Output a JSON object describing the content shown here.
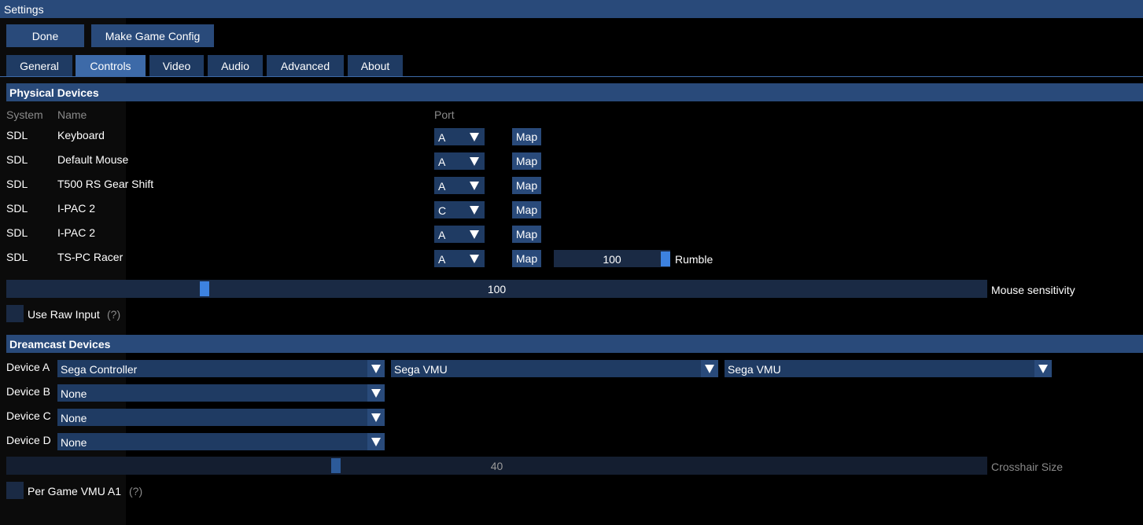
{
  "window": {
    "title": "Settings"
  },
  "toolbar": {
    "done_label": "Done",
    "make_config_label": "Make Game Config"
  },
  "tabs": [
    "General",
    "Controls",
    "Video",
    "Audio",
    "Advanced",
    "About"
  ],
  "active_tab": "Controls",
  "physical": {
    "section_title": "Physical Devices",
    "columns": {
      "system": "System",
      "name": "Name",
      "port": "Port"
    },
    "map_label": "Map",
    "devices": [
      {
        "system": "SDL",
        "name": "Keyboard",
        "port": "A"
      },
      {
        "system": "SDL",
        "name": "Default Mouse",
        "port": "A"
      },
      {
        "system": "SDL",
        "name": "T500 RS Gear Shift",
        "port": "A"
      },
      {
        "system": "SDL",
        "name": "I-PAC 2",
        "port": "C"
      },
      {
        "system": "SDL",
        "name": "I-PAC 2",
        "port": "A"
      },
      {
        "system": "SDL",
        "name": "TS-PC Racer",
        "port": "A"
      }
    ],
    "rumble": {
      "value": "100",
      "label": "Rumble"
    },
    "mouse_sensitivity": {
      "value": "100",
      "label": "Mouse sensitivity"
    },
    "raw_input": {
      "label": "Use Raw Input",
      "help": "(?)"
    }
  },
  "dreamcast": {
    "section_title": "Dreamcast Devices",
    "devices": [
      {
        "label": "Device A",
        "main": "Sega Controller",
        "exp1": "Sega VMU",
        "exp2": "Sega VMU"
      },
      {
        "label": "Device B",
        "main": "None"
      },
      {
        "label": "Device C",
        "main": "None"
      },
      {
        "label": "Device D",
        "main": "None"
      }
    ],
    "crosshair": {
      "value": "40",
      "label": "Crosshair Size"
    },
    "per_game_vmu": {
      "label": "Per Game VMU A1",
      "help": "(?)"
    }
  },
  "colors": {
    "accent": "#294a7a",
    "active_tab": "#3d6aa8",
    "grab": "#3d82e0"
  }
}
